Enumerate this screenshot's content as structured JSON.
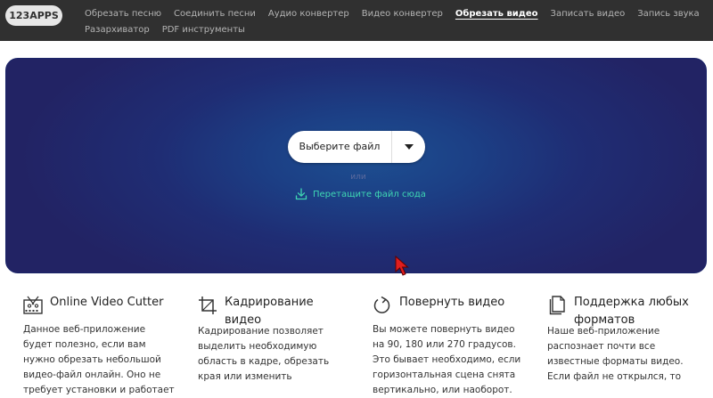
{
  "header": {
    "logo": "123APPS",
    "nav_row1": [
      {
        "label": "Обрезать песню",
        "active": false
      },
      {
        "label": "Соединить песни",
        "active": false
      },
      {
        "label": "Аудио конвертер",
        "active": false
      },
      {
        "label": "Видео конвертер",
        "active": false
      },
      {
        "label": "Обрезать видео",
        "active": true
      },
      {
        "label": "Записать видео",
        "active": false
      },
      {
        "label": "Запись звука",
        "active": false
      }
    ],
    "nav_row2": [
      {
        "label": "Разархиватор",
        "active": false
      },
      {
        "label": "PDF инструменты",
        "active": false
      }
    ]
  },
  "hero": {
    "select_button_label": "Выберите файл",
    "or_text": "или",
    "drop_link_label": "Перетащите файл сюда"
  },
  "features": [
    {
      "icon": "film-scissors-icon",
      "title": "Online Video Cutter",
      "text": "Данное веб-приложение будет полезно, если вам нужно обрезать небольшой видео-файл онлайн. Оно не требует установки и работает"
    },
    {
      "icon": "crop-icon",
      "title": "Кадрирование видео",
      "text": "Кадрирование позволяет выделить необходимую область в кадре, обрезать края или изменить"
    },
    {
      "icon": "rotate-icon",
      "title": "Повернуть видео",
      "text": "Вы можете повернуть видео на 90, 180 или 270 градусов. Это бывает необходимо, если горизонтальная сцена снята вертикально, или наоборот."
    },
    {
      "icon": "files-icon",
      "title": "Поддержка любых форматов",
      "text": "Наше веб-приложение распознает почти все известные форматы видео. Если файл не открылся, то"
    }
  ],
  "colors": {
    "header_bg": "#303030",
    "hero_bg": "#1f2d74",
    "accent_link": "#3fd6b3"
  }
}
